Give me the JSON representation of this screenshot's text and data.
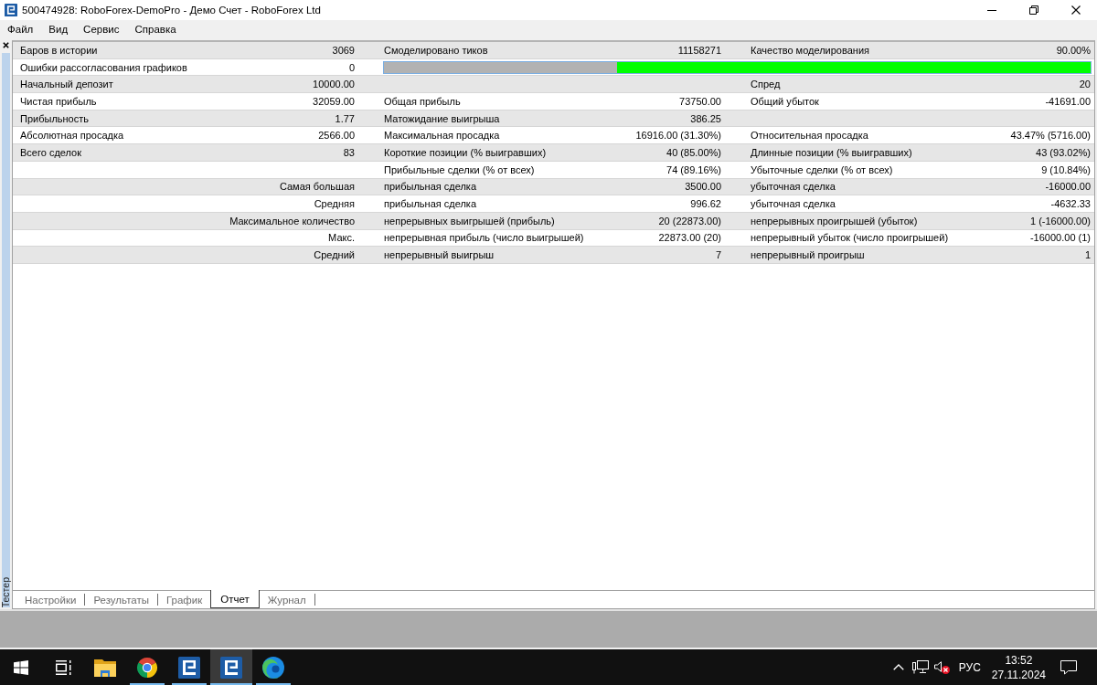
{
  "window": {
    "title": "500474928: RoboForex-DemoPro - Демо Счет - RoboForex Ltd"
  },
  "menu": [
    "Файл",
    "Вид",
    "Сервис",
    "Справка"
  ],
  "panel": {
    "title": "Тестер"
  },
  "report": {
    "rows": [
      {
        "label_1": "Баров в истории",
        "value_1": "3069",
        "label_2": "Смоделировано тиков",
        "value_2": "11158271",
        "label_3": "Качество моделирования",
        "value_3": "90.00%"
      },
      {
        "label_1": "Ошибки рассогласования графиков",
        "value_1": "0",
        "bar": {
          "level": 0.67
        }
      },
      {
        "label_1": "Начальный депозит",
        "value_1": "10000.00",
        "label_3": "Спред",
        "value_3": "20"
      },
      {
        "label_1": "Чистая прибыль",
        "value_1": "32059.00",
        "label_2": "Общая прибыль",
        "value_2": "73750.00",
        "label_3": "Общий убыток",
        "value_3": "-41691.00"
      },
      {
        "label_1": "Прибыльность",
        "value_1": "1.77",
        "label_2": "Матожидание выигрыша",
        "value_2": "386.25"
      },
      {
        "label_1": "Абсолютная просадка",
        "value_1": "2566.00",
        "label_2": "Максимальная просадка",
        "value_2": "16916.00 (31.30%)",
        "label_3": "Относительная просадка",
        "value_3": "43.47% (5716.00)"
      },
      {
        "label_1": "Всего сделок",
        "value_1": "83",
        "label_2": "Короткие позиции (% выигравших)",
        "value_2": "40 (85.00%)",
        "label_3": "Длинные позиции (% выигравших)",
        "value_3": "43 (93.02%)"
      },
      {
        "label_2": "Прибыльные сделки (% от всех)",
        "value_2": "74 (89.16%)",
        "label_3": "Убыточные сделки (% от всех)",
        "value_3": "9 (10.84%)"
      },
      {
        "heading": "Самая большая",
        "label_2": "прибыльная сделка",
        "value_2": "3500.00",
        "label_3": "убыточная сделка",
        "value_3": "-16000.00"
      },
      {
        "heading": "Средняя",
        "label_2": "прибыльная сделка",
        "value_2": "996.62",
        "label_3": "убыточная сделка",
        "value_3": "-4632.33"
      },
      {
        "heading": "Максимальное количество",
        "label_2": "непрерывных выигрышей (прибыль)",
        "value_2": "20 (22873.00)",
        "label_3": "непрерывных проигрышей (убыток)",
        "value_3": "1 (-16000.00)"
      },
      {
        "heading": "Макс.",
        "label_2": "непрерывная прибыль (число выигрышей)",
        "value_2": "22873.00 (20)",
        "label_3": "непрерывный убыток (число проигрышей)",
        "value_3": "-16000.00 (1)"
      },
      {
        "heading": "Средний",
        "label_2": "непрерывный выигрыш",
        "value_2": "7",
        "label_3": "непрерывный проигрыш",
        "value_3": "1"
      }
    ]
  },
  "tabs": [
    {
      "label": "Настройки",
      "selected": false
    },
    {
      "label": "Результаты",
      "selected": false
    },
    {
      "label": "График",
      "selected": false
    },
    {
      "label": "Отчет",
      "selected": true
    },
    {
      "label": "Журнал",
      "selected": false
    }
  ],
  "taskbar": {
    "apps": [
      {
        "kind": "explorer",
        "running": false,
        "active": false
      },
      {
        "kind": "chrome",
        "running": true,
        "active": false
      },
      {
        "kind": "terminal",
        "running": true,
        "active": false
      },
      {
        "kind": "terminal",
        "running": true,
        "active": true
      },
      {
        "kind": "edge",
        "running": true,
        "active": false
      }
    ],
    "language": "РУС",
    "time": "13:52",
    "date": "27.11.2024"
  }
}
